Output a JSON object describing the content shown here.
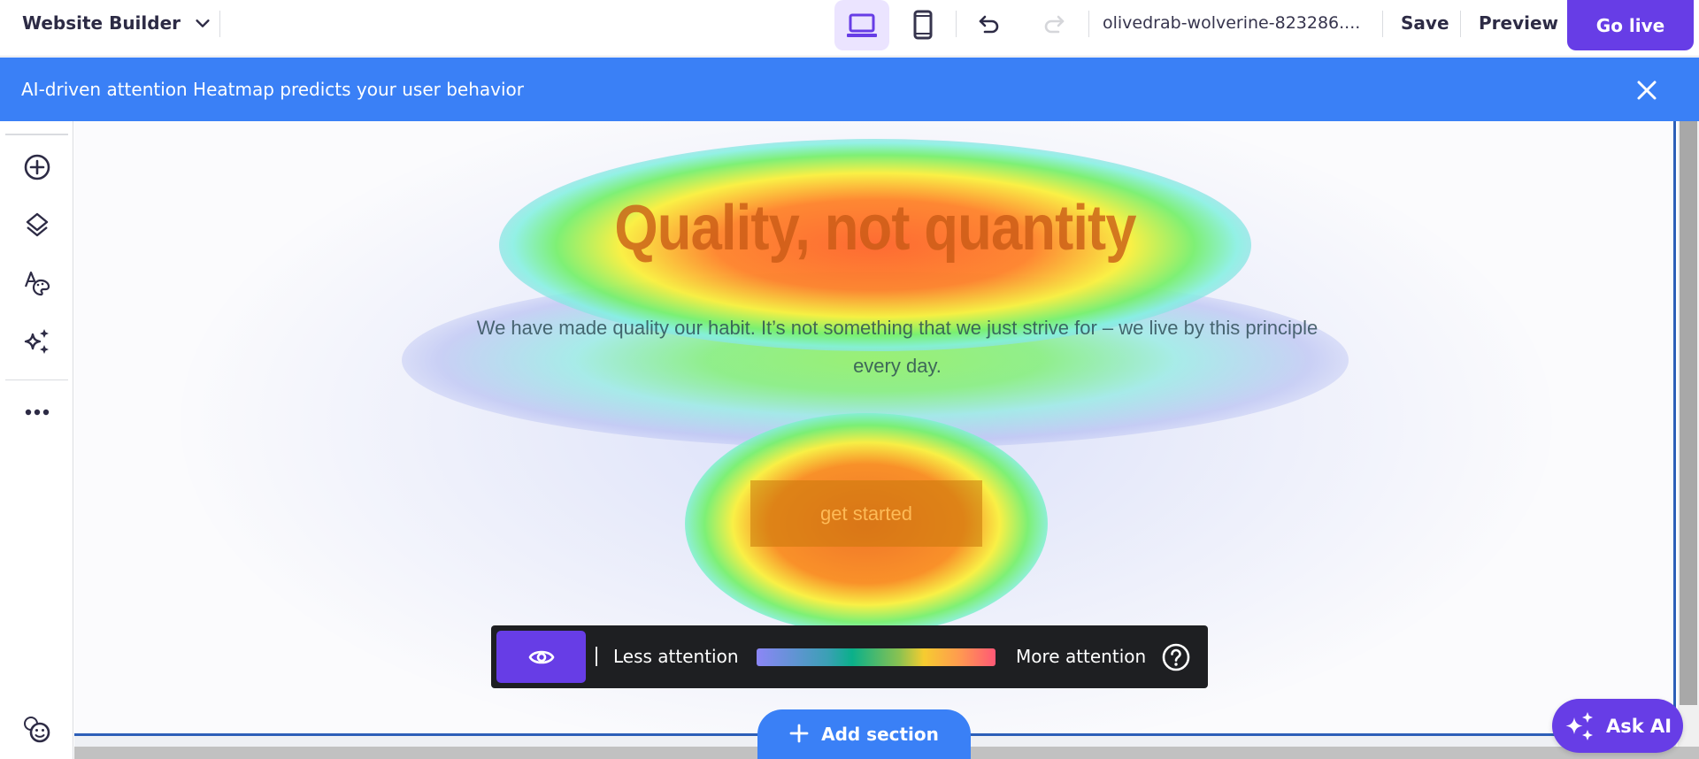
{
  "topbar": {
    "brand": "Website Builder",
    "device_desktop": "desktop-view",
    "device_mobile": "mobile-view",
    "site_name": "olivedrab-wolverine-823286....",
    "save_label": "Save",
    "preview_label": "Preview",
    "golive_label": "Go live"
  },
  "banner": {
    "message": "AI-driven attention Heatmap predicts your user behavior"
  },
  "sidebar": {
    "items": [
      {
        "icon": "add-element-icon"
      },
      {
        "icon": "layers-icon"
      },
      {
        "icon": "styles-icon"
      },
      {
        "icon": "ai-tools-icon"
      },
      {
        "icon": "more-icon"
      }
    ],
    "bottom_icon": "feedback-icon"
  },
  "canvas": {
    "headline": "Quality, not quantity",
    "paragraph": "We have made quality our habit. It’s not something that we just strive for – we live by this principle every day.",
    "cta_label": "get started"
  },
  "heatmap_legend": {
    "less_label": "Less attention",
    "more_label": "More attention",
    "gradient_colors": [
      "#8c86f6",
      "#0ab08a",
      "#f6cc30",
      "#ff5876"
    ]
  },
  "add_section_label": "Add section",
  "ask_ai_label": "Ask AI",
  "colors": {
    "primary": "#673de6",
    "banner": "#3a80f6",
    "canvas_border": "#2d5fb8"
  }
}
